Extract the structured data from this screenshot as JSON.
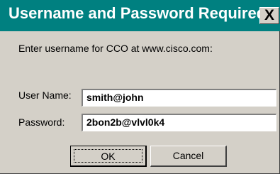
{
  "window": {
    "title": "Username and Password Required",
    "close_label": "X"
  },
  "prompt": "Enter username for CCO at www.cisco.com:",
  "form": {
    "username_label": "User Name:",
    "username_value": "smith@john",
    "password_label": "Password:",
    "password_value": "2bon2b@vlvl0k4"
  },
  "buttons": {
    "ok_label": "OK",
    "cancel_label": "Cancel"
  },
  "colors": {
    "titlebar": "#008080",
    "dialog_face": "#d4d0c8",
    "field_background": "#ffffff"
  }
}
